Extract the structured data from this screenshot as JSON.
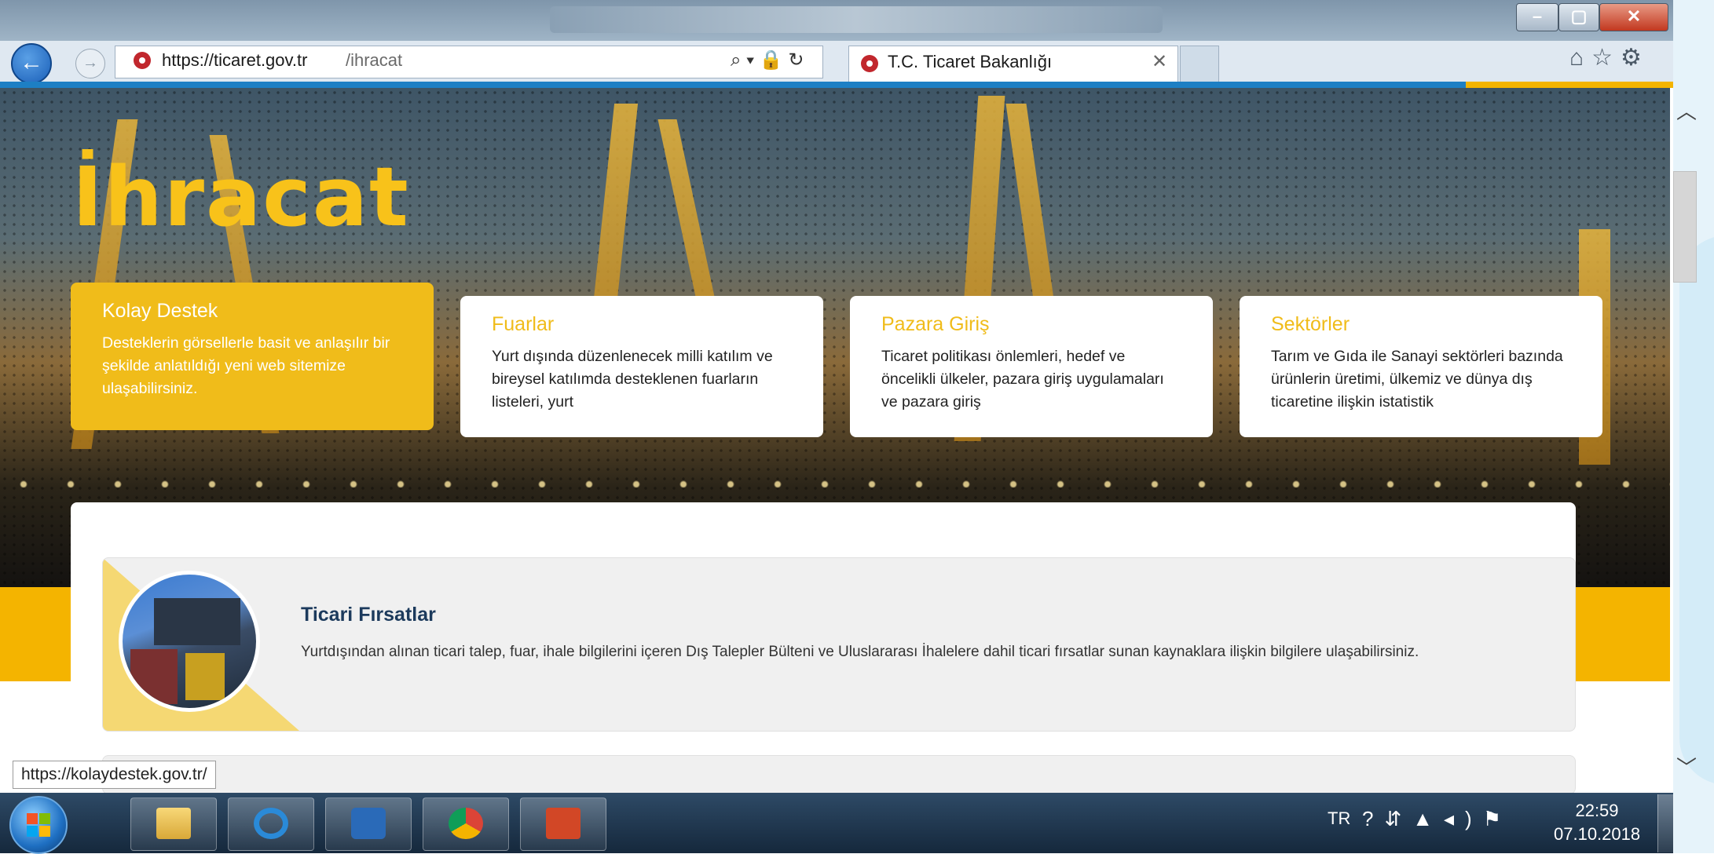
{
  "browser": {
    "url_host": "https://ticaret.gov.tr",
    "url_path": "/ihracat",
    "tab_title": "T.C. Ticaret Bakanlığı",
    "status_url": "https://kolaydestek.gov.tr/"
  },
  "hero": {
    "title": "İhracat"
  },
  "cards": [
    {
      "title": "Kolay Destek",
      "text": "Desteklerin görsellerle basit ve anlaşılır bir şekilde anlatıldığı yeni web sitemize ulaşabilirsiniz."
    },
    {
      "title": "Fuarlar",
      "text": "Yurt dışında düzenlenecek milli katılım ve bireysel katılımda desteklenen fuarların listeleri, yurt"
    },
    {
      "title": "Pazara Giriş",
      "text": "Ticaret politikası önlemleri, hedef ve öncelikli ülkeler, pazara giriş uygulamaları ve pazara giriş"
    },
    {
      "title": "Sektörler",
      "text": "Tarım ve Gıda ile Sanayi sektörleri bazında ürünlerin üretimi, ülkemiz ve dünya dış ticaretine ilişkin istatistik"
    }
  ],
  "section": {
    "title": "Ticari Fırsatlar",
    "text": "Yurtdışından alınan ticari talep, fuar, ihale bilgilerini içeren Dış Talepler Bülteni ve Uluslararası İhalelere dahil ticari fırsatlar sunan kaynaklara ilişkin bilgilere ulaşabilirsiniz."
  },
  "taskbar": {
    "language": "TR",
    "time": "22:59",
    "date": "07.10.2018",
    "apps": [
      "folder-icon",
      "ie-icon",
      "media-player-icon",
      "chrome-icon",
      "powerpoint-icon"
    ]
  },
  "colors": {
    "accent_yellow": "#f0bc1a",
    "accent_blue": "#1d7fc4",
    "section_title": "#1c3a5c"
  }
}
